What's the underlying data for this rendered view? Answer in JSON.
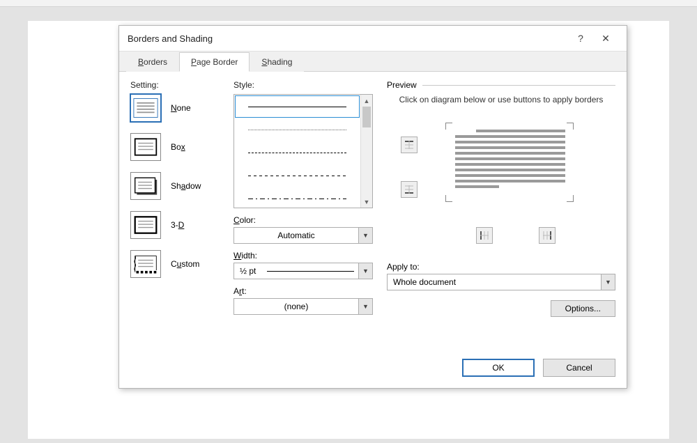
{
  "dialog": {
    "title": "Borders and Shading",
    "help_icon": "?",
    "close_icon": "✕"
  },
  "tabs": {
    "borders": "Borders",
    "page_border": "Page Border",
    "shading": "Shading"
  },
  "setting": {
    "label": "Setting:",
    "none": "None",
    "box": "Box",
    "shadow": "Shadow",
    "threed": "3-D",
    "custom": "Custom"
  },
  "style": {
    "label": "Style:",
    "color_label": "Color:",
    "color_value": "Automatic",
    "width_label": "Width:",
    "width_value": "½ pt",
    "art_label": "Art:",
    "art_value": "(none)"
  },
  "preview": {
    "label": "Preview",
    "help": "Click on diagram below or use buttons to apply borders",
    "apply_label": "Apply to:",
    "apply_value": "Whole document",
    "options": "Options..."
  },
  "footer": {
    "ok": "OK",
    "cancel": "Cancel"
  }
}
